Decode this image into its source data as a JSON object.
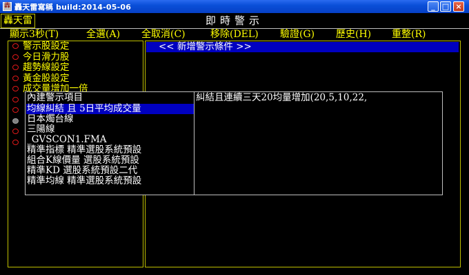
{
  "window": {
    "title": "轟天雷寫稱 build:2014-05-06",
    "app_icon": "轟",
    "minimize": "_",
    "maximize": "□",
    "close": "×"
  },
  "header": {
    "logo": "轟天雷",
    "page_title": "即時警示"
  },
  "menu": {
    "items": [
      "顯示3秒(T)",
      "全選(A)",
      "全取消(C)",
      "移除(DEL)",
      "驗證(G)",
      "歷史(H)",
      "重整(R)"
    ]
  },
  "alerts": {
    "items": [
      {
        "label": "警示股設定",
        "selected": false
      },
      {
        "label": "今日滑力股",
        "selected": false
      },
      {
        "label": "趨勢線設定",
        "selected": false
      },
      {
        "label": "黃金股設定",
        "selected": false
      },
      {
        "label": "成交量增加一倍",
        "selected": false
      },
      {
        "label": "",
        "selected": false
      },
      {
        "label": "",
        "selected": false
      },
      {
        "label": "",
        "selected": true
      },
      {
        "label": "",
        "selected": false
      },
      {
        "label": "",
        "selected": false
      }
    ]
  },
  "new_condition": {
    "label": "<< 新增警示條件 >>"
  },
  "popup": {
    "items": [
      {
        "label": "內建警示項目",
        "highlight": false
      },
      {
        "label": "均線糾結 且 5日平均成交量",
        "highlight": true
      },
      {
        "label": "日本燭台線",
        "highlight": false
      },
      {
        "label": "三陽線",
        "highlight": false
      },
      {
        "label": "_GVSCON1.FMA",
        "highlight": false
      },
      {
        "label": "精準指標 精準選股系統預設",
        "highlight": false
      },
      {
        "label": "組合K線價量 選股系統預設",
        "highlight": false
      },
      {
        "label": "精準KD  選股系統預設二代",
        "highlight": false
      },
      {
        "label": "精準均線 精準選股系統預設",
        "highlight": false
      }
    ]
  },
  "description": {
    "text": "糾結且連續三天20均量增加(20,5,10,22,"
  },
  "colors": {
    "background": "#000000",
    "menu_text": "#ffff00",
    "highlight_bar": "#0000c0",
    "radio": "#e01818",
    "titlebar": "#0a4fd8"
  }
}
